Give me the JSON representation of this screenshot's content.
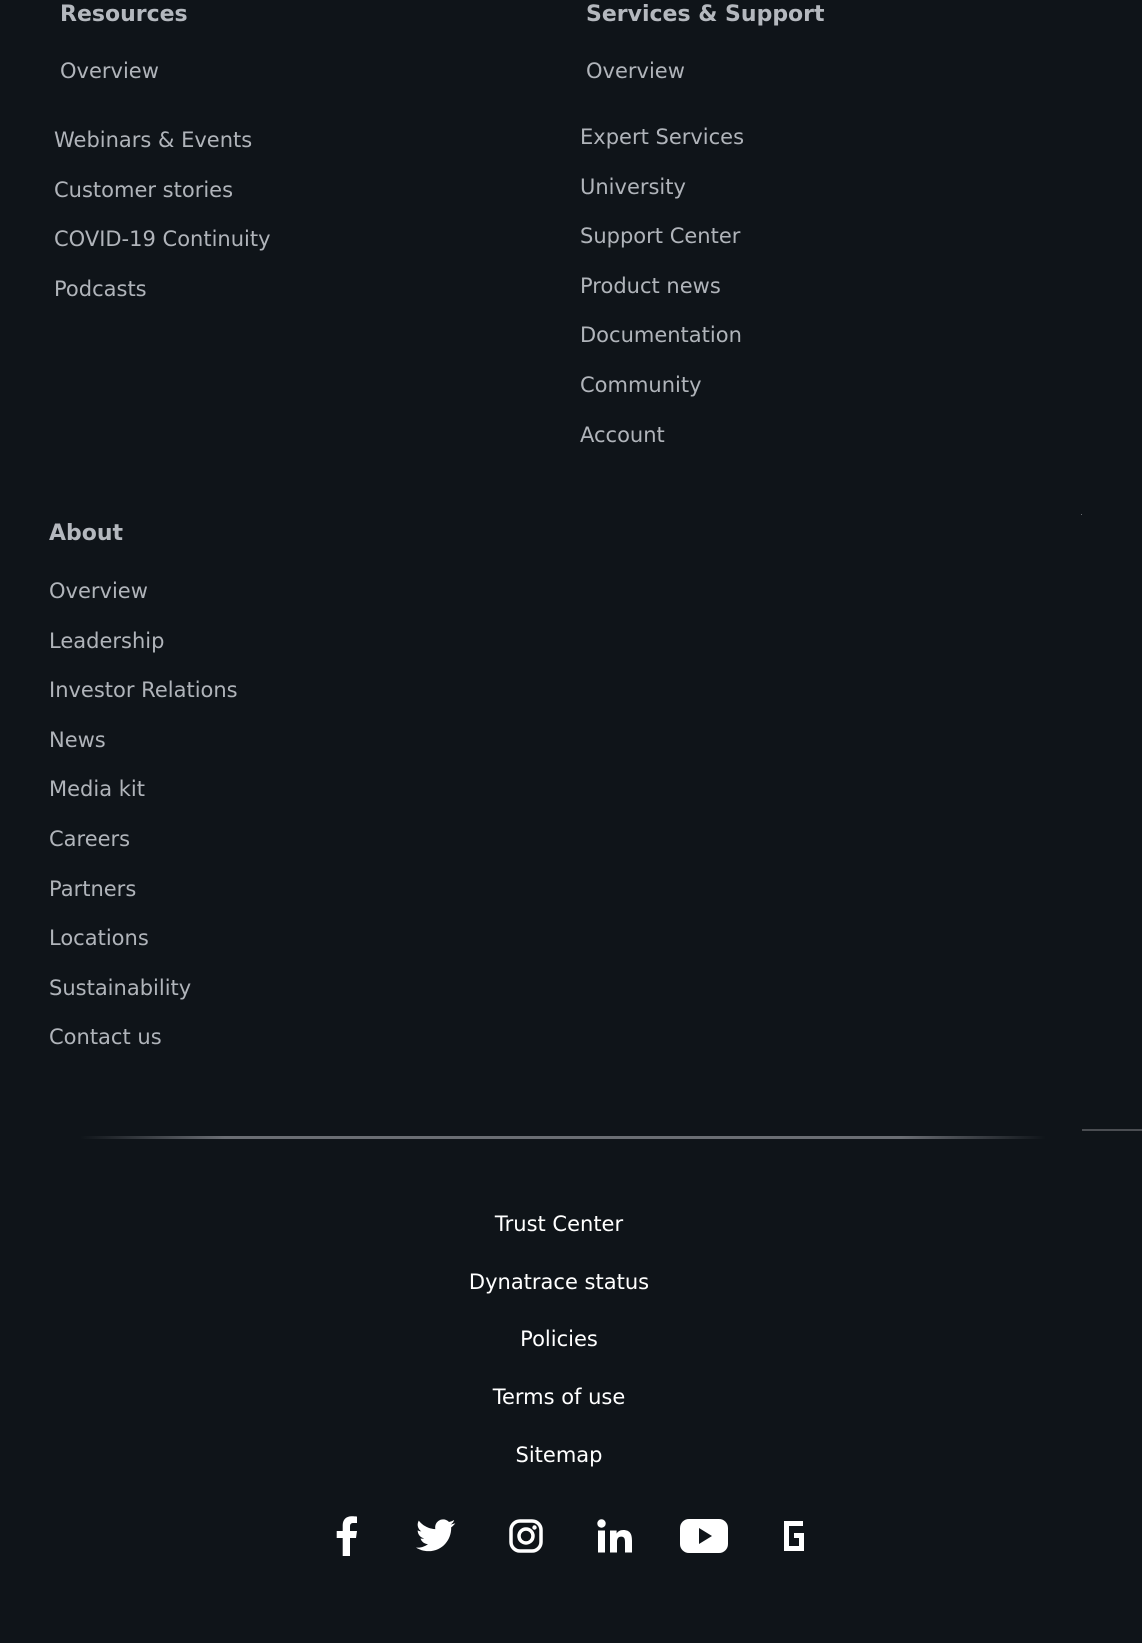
{
  "resources": {
    "heading": "Resources",
    "items": [
      "Overview",
      "Webinars & Events",
      "Customer stories",
      "COVID-19 Continuity",
      "Podcasts"
    ]
  },
  "services": {
    "heading": "Services & Support",
    "items": [
      "Overview",
      "Expert Services",
      "University",
      "Support Center",
      "Product news",
      "Documentation",
      "Community",
      "Account"
    ]
  },
  "about": {
    "heading": "About",
    "items": [
      "Overview",
      "Leadership",
      "Investor Relations",
      "News",
      "Media kit",
      "Careers",
      "Partners",
      "Locations",
      "Sustainability",
      "Contact us"
    ]
  },
  "bottom_links": [
    "Trust Center",
    "Dynatrace status",
    "Policies",
    "Terms of use",
    "Sitemap"
  ],
  "social": [
    "facebook-icon",
    "twitter-icon",
    "instagram-icon",
    "linkedin-icon",
    "youtube-icon",
    "g2-icon"
  ],
  "colors": {
    "background": "#0f1419",
    "link": "#b0b4ba",
    "heading": "#b4b8be",
    "bottom_link": "#ffffff"
  }
}
